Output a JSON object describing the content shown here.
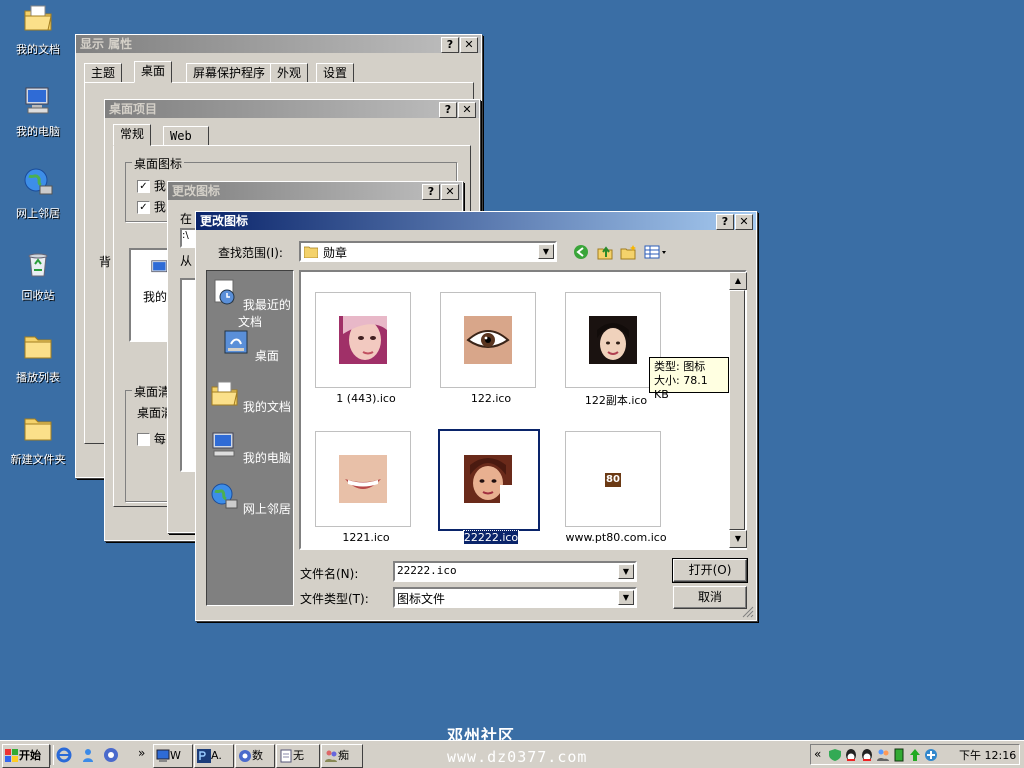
{
  "desktop": {
    "icons": [
      {
        "label": "我的文档",
        "icon": "folder-docs-icon"
      },
      {
        "label": "我的电脑",
        "icon": "computer-icon"
      },
      {
        "label": "网上邻居",
        "icon": "network-icon"
      },
      {
        "label": "回收站",
        "icon": "recycle-bin-icon"
      },
      {
        "label": "播放列表",
        "icon": "folder-icon"
      },
      {
        "label": "新建文件夹",
        "icon": "folder-icon"
      }
    ],
    "watermark_line1": "邓州社区",
    "watermark_line2": "www.dz0377.com"
  },
  "display_props": {
    "title": "显示 属性",
    "tabs": [
      "主题",
      "桌面",
      "屏幕保护程序",
      "外观",
      "设置"
    ]
  },
  "desktop_items": {
    "title": "桌面项目",
    "tabs": [
      "常规",
      "Web"
    ],
    "group_icons": "桌面图标",
    "check1": "我",
    "check2": "我",
    "partial_a": "我的",
    "partial_b": "背",
    "group_cleanup": "桌面清",
    "cleanup_text": "桌面清",
    "every_label": "每"
  },
  "change_icon_back": {
    "title": "更改图标",
    "partial_in": "在",
    "partial_from": "从",
    "path_partial": ":\\"
  },
  "dialog": {
    "title": "更改图标",
    "lookin_label": "查找范围(I):",
    "lookin_value": "勋章",
    "places": [
      "我最近的文档",
      "桌面",
      "我的文档",
      "我的电脑",
      "网上邻居"
    ],
    "files": [
      {
        "name": "1 (443).ico"
      },
      {
        "name": "122.ico"
      },
      {
        "name": "122副本.ico"
      },
      {
        "name": "1221.ico"
      },
      {
        "name": "22222.ico"
      },
      {
        "name": "www.pt80.com.ico"
      }
    ],
    "pt80_text": "80",
    "tooltip_type": "类型: 图标",
    "tooltip_size": "大小: 78.1 KB",
    "filename_label": "文件名(N):",
    "filename_value": "22222.ico",
    "filetype_label": "文件类型(T):",
    "filetype_value": "图标文件",
    "open_button": "打开(O)",
    "cancel_button": "取消"
  },
  "taskbar": {
    "start": "开始",
    "chevron": "»",
    "tasks": [
      "W",
      "A.",
      "数",
      "无",
      "痴"
    ],
    "tray_chevron": "«",
    "clock": "下午 12:16"
  },
  "colors": {
    "desktop": "#3a6ea5",
    "title_active": "#0a246a",
    "face": "#d4d0c8"
  }
}
